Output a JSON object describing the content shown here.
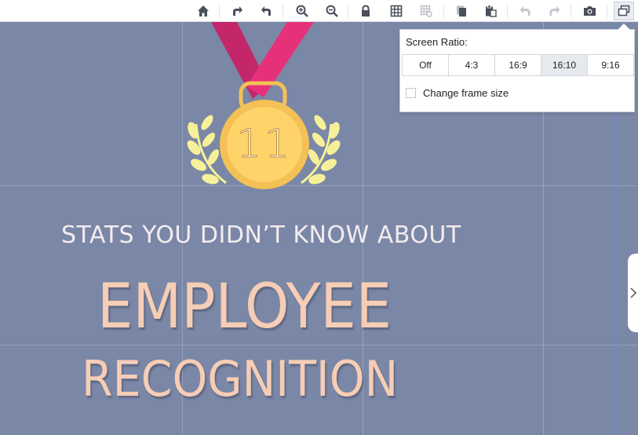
{
  "toolbar": {
    "buttons": [
      {
        "name": "home",
        "icon": "home-icon"
      },
      {
        "name": "redo-all",
        "icon": "redo-arrow-icon"
      },
      {
        "name": "undo-all",
        "icon": "undo-arrow-icon"
      },
      {
        "name": "zoom-in",
        "icon": "zoom-in-icon"
      },
      {
        "name": "zoom-out",
        "icon": "zoom-out-icon"
      },
      {
        "name": "lock",
        "icon": "lock-icon"
      },
      {
        "name": "grid",
        "icon": "grid-icon"
      },
      {
        "name": "grid-settings",
        "icon": "grid-settings-icon"
      },
      {
        "name": "copy",
        "icon": "copy-icon"
      },
      {
        "name": "paste",
        "icon": "paste-icon"
      },
      {
        "name": "undo",
        "icon": "undo-icon"
      },
      {
        "name": "redo",
        "icon": "redo-icon"
      },
      {
        "name": "screenshot",
        "icon": "camera-icon"
      },
      {
        "name": "screen-ratio",
        "icon": "screen-ratio-icon"
      }
    ]
  },
  "canvas": {
    "background_color": "#7b87a6",
    "medal_number": "11",
    "subtitle": "STATS YOU DIDN’T KNOW ABOUT",
    "title_line1": "EMPLOYEE",
    "title_line2": "RECOGNITION",
    "colors": {
      "ribbon": "#e6317a",
      "medal": "#fdd36a",
      "laurel": "#f6f199",
      "title": "#f6cdb5"
    }
  },
  "popup": {
    "title": "Screen Ratio:",
    "ratios": [
      "Off",
      "4:3",
      "16:9",
      "16:10",
      "9:16"
    ],
    "selected_ratio": "16:10",
    "checkbox_label": "Change frame size",
    "checkbox_checked": false
  }
}
